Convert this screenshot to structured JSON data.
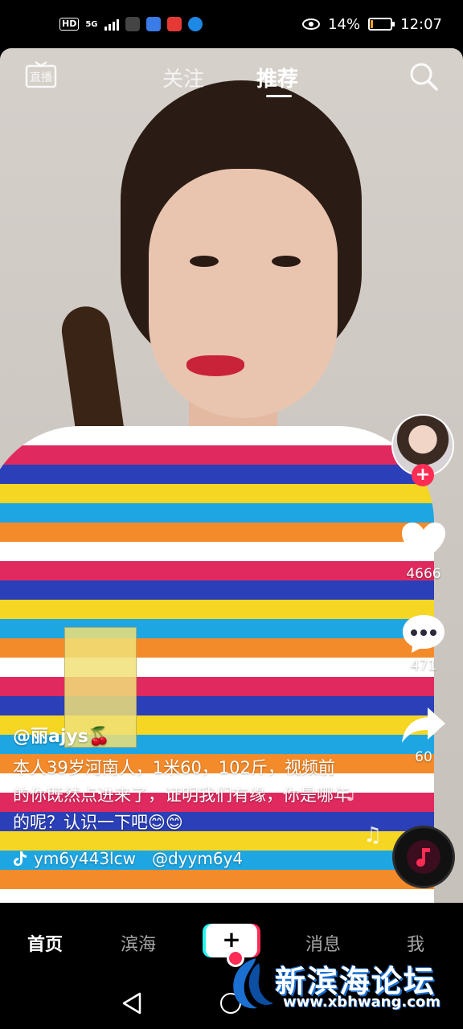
{
  "status_bar": {
    "hd": "HD",
    "network": "5G",
    "battery_percent": "14%",
    "battery_level": 0.14,
    "time": "12:07"
  },
  "top_nav": {
    "live_label": "直播",
    "tab_follow": "关注",
    "tab_recommend": "推荐"
  },
  "sidebar": {
    "likes": "4666",
    "comments": "471",
    "shares": "60"
  },
  "caption": {
    "username": "@丽ajys🍒",
    "description": "本人39岁河南人，1米60，102斤，视频前的你既然点进来了，证明我们有缘，你是哪年的呢？认识一下吧😊😊",
    "account": "ym6y443lcw",
    "mention": "@dyym6y4"
  },
  "bottom_nav": {
    "home": "首页",
    "binhai": "滨海",
    "create": "+",
    "messages": "消息",
    "me": "我"
  },
  "watermark": {
    "title": "新滨海论坛",
    "url": "www.xbhwang.com"
  },
  "colors": {
    "accent_red": "#fe2c55",
    "accent_cyan": "#25f4ee",
    "battery_low": "#f5a623"
  }
}
